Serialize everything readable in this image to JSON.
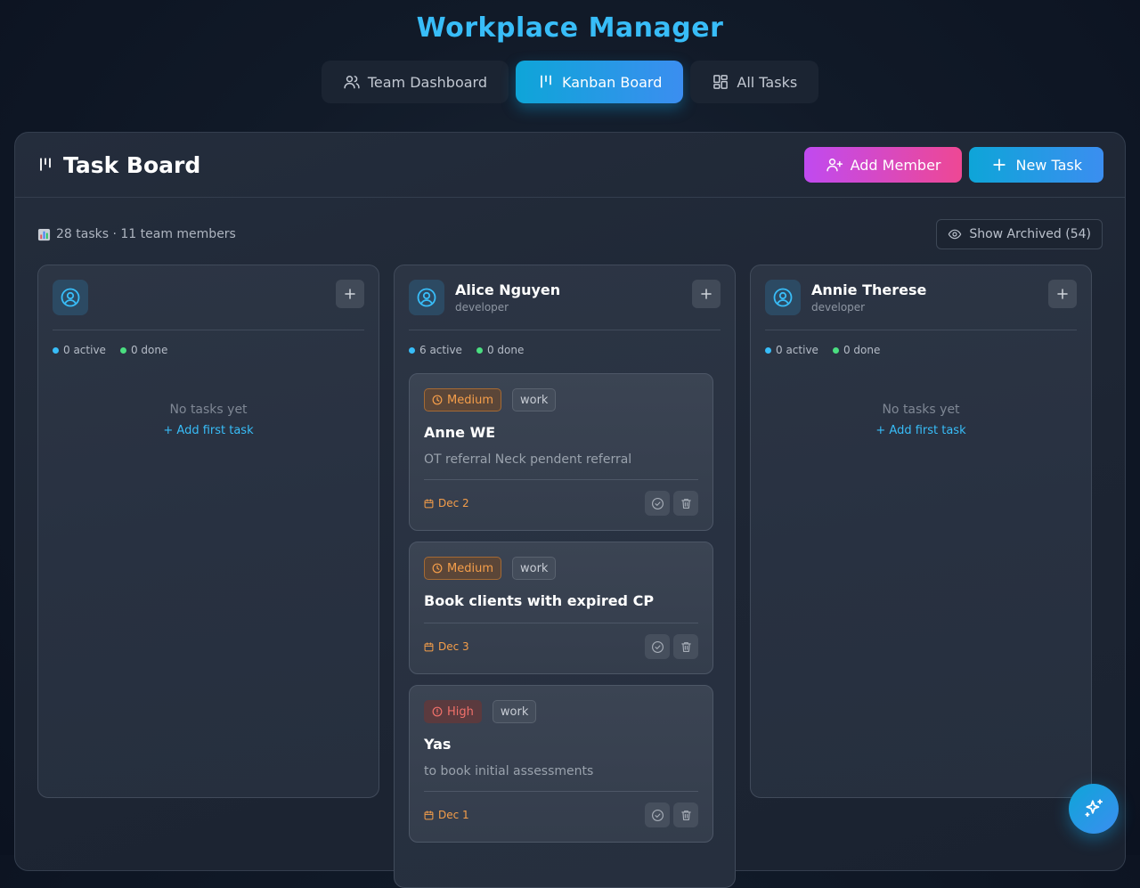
{
  "app": {
    "title": "Workplace Manager"
  },
  "nav": {
    "tabs": [
      {
        "label": "Team Dashboard",
        "icon": "users-icon"
      },
      {
        "label": "Kanban Board",
        "icon": "kanban-icon",
        "active": true
      },
      {
        "label": "All Tasks",
        "icon": "grid-icon"
      }
    ]
  },
  "board": {
    "title": "Task Board",
    "add_member_label": "Add Member",
    "new_task_label": "New Task",
    "stats": "28 tasks · 11 team members",
    "show_archived_label": "Show Archived (54)"
  },
  "columns": [
    {
      "name": "",
      "role": "",
      "active_count": "0 active",
      "done_count": "0 done",
      "empty_title": "No tasks yet",
      "empty_link": "+ Add first task"
    },
    {
      "name": "Alice Nguyen",
      "role": "developer",
      "active_count": "6 active",
      "done_count": "0 done",
      "tasks": [
        {
          "priority": "Medium",
          "category": "work",
          "title": "Anne WE",
          "description": "OT referral Neck pendent referral",
          "due": "Dec 2"
        },
        {
          "priority": "Medium",
          "category": "work",
          "title": "Book clients with expired CP",
          "description": "",
          "due": "Dec 3"
        },
        {
          "priority": "High",
          "category": "work",
          "title": "Yas",
          "description": "to book initial assessments",
          "due": "Dec 1"
        }
      ]
    },
    {
      "name": "Annie Therese",
      "role": "developer",
      "active_count": "0 active",
      "done_count": "0 done",
      "empty_title": "No tasks yet",
      "empty_link": "+ Add first task"
    }
  ],
  "colors": {
    "accent": "#38bdf8",
    "priority_medium": "#f59e4a",
    "priority_high": "#f0706a",
    "member_button": "#c04af0",
    "active_dot": "#38bdf8",
    "done_dot": "#4ade80"
  }
}
